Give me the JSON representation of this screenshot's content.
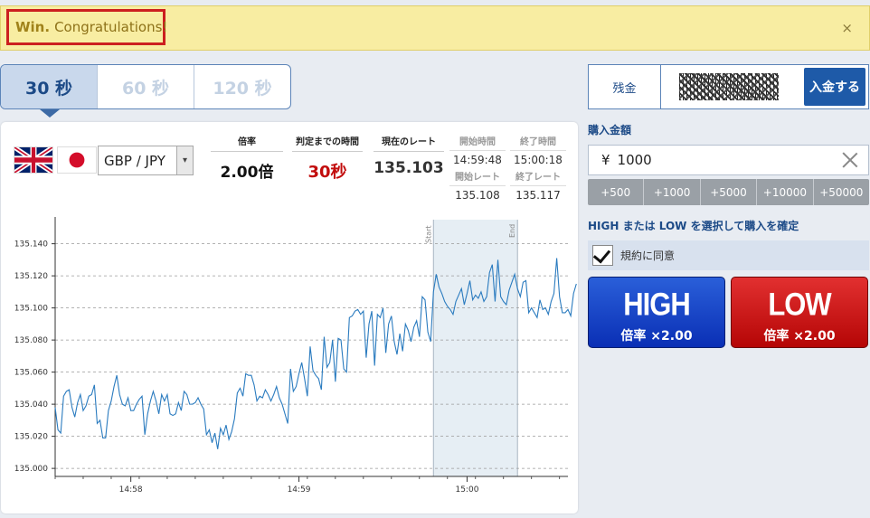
{
  "banner": {
    "strong": "Win.",
    "message": "Congratulations!",
    "close": "×"
  },
  "tabs": [
    {
      "label": "30 秒",
      "active": true
    },
    {
      "label": "60 秒",
      "active": false
    },
    {
      "label": "120 秒",
      "active": false
    }
  ],
  "pair": {
    "value": "GBP / JPY",
    "arrow": "▾"
  },
  "stats": {
    "payout": {
      "label": "倍率",
      "value": "2.00倍"
    },
    "time_left": {
      "label": "判定までの時間",
      "value": "30秒"
    },
    "current_rate": {
      "label": "現在のレート",
      "value": "135.103"
    },
    "start_time": {
      "label": "開始時間",
      "value": "14:59:48"
    },
    "end_time": {
      "label": "終了時間",
      "value": "15:00:18"
    },
    "start_rate": {
      "label": "開始レート",
      "value": "135.108"
    },
    "end_rate": {
      "label": "終了レート",
      "value": "135.117"
    }
  },
  "balance": {
    "label": "残金",
    "deposit_label": "入金する"
  },
  "purchase": {
    "title": "購入金額",
    "currency": "¥",
    "amount": "1000",
    "quick_amounts": [
      "+500",
      "+1000",
      "+5000",
      "+10000",
      "+50000"
    ],
    "confirm_text": "HIGH または LOW を選択して購入を確定",
    "agree_label": "規約に同意",
    "agree_checked": true
  },
  "high_button": {
    "title": "HIGH",
    "rate": "倍率 ×2.00",
    "color": "#0a2fb5"
  },
  "low_button": {
    "title": "LOW",
    "rate": "倍率 ×2.00",
    "color": "#b50606"
  },
  "colors": {
    "accent": "#1c4a87",
    "line": "#2a7bbf",
    "win_border": "#cc1f1f"
  },
  "chart_data": {
    "type": "line",
    "ylim": [
      134.995,
      135.155
    ],
    "yticks": [
      135.0,
      135.02,
      135.04,
      135.06,
      135.08,
      135.1,
      135.12,
      135.14
    ],
    "ytick_labels": [
      "135.000",
      "135.020",
      "135.040",
      "135.060",
      "135.080",
      "135.100",
      "135.120",
      "135.140"
    ],
    "xticks": [
      {
        "t": 27,
        "label": "14:58"
      },
      {
        "t": 87,
        "label": "14:59"
      },
      {
        "t": 147,
        "label": "15:00"
      }
    ],
    "xlim": [
      0,
      183
    ],
    "window": {
      "start": 135,
      "end": 165,
      "start_label": "Start",
      "end_label": "End"
    },
    "grid": true,
    "series": [
      {
        "values": [
          135.038,
          135.024,
          135.022,
          135.045,
          135.048,
          135.049,
          135.038,
          135.032,
          135.041,
          135.046,
          135.036,
          135.039,
          135.045,
          135.046,
          135.052,
          135.028,
          135.03,
          135.019,
          135.019,
          135.036,
          135.042,
          135.051,
          135.058,
          135.046,
          135.04,
          135.039,
          135.044,
          135.036,
          135.036,
          135.04,
          135.043,
          135.045,
          135.021,
          135.034,
          135.042,
          135.048,
          135.042,
          135.034,
          135.046,
          135.042,
          135.046,
          135.034,
          135.033,
          135.034,
          135.041,
          135.036,
          135.048,
          135.046,
          135.04,
          135.04,
          135.041,
          135.044,
          135.04,
          135.037,
          135.021,
          135.024,
          135.016,
          135.022,
          135.012,
          135.025,
          135.021,
          135.027,
          135.018,
          135.023,
          135.031,
          135.047,
          135.05,
          135.045,
          135.059,
          135.058,
          135.058,
          135.052,
          135.042,
          135.045,
          135.044,
          135.049,
          135.046,
          135.042,
          135.046,
          135.051,
          135.044,
          135.04,
          135.034,
          135.028,
          135.062,
          135.048,
          135.051,
          135.059,
          135.066,
          135.056,
          135.045,
          135.076,
          135.061,
          135.058,
          135.056,
          135.049,
          135.082,
          135.063,
          135.066,
          135.08,
          135.054,
          135.081,
          135.08,
          135.062,
          135.06,
          135.094,
          135.095,
          135.098,
          135.099,
          135.096,
          135.098,
          135.069,
          135.09,
          135.098,
          135.064,
          135.096,
          135.094,
          135.1,
          135.072,
          135.09,
          135.095,
          135.079,
          135.071,
          135.084,
          135.073,
          135.09,
          135.086,
          135.079,
          135.088,
          135.092,
          135.082,
          135.107,
          135.105,
          135.085,
          135.079,
          135.11,
          135.121,
          135.113,
          135.109,
          135.104,
          135.101,
          135.099,
          135.096,
          135.104,
          135.108,
          135.112,
          135.102,
          135.109,
          135.117,
          135.105,
          135.108,
          135.106,
          135.11,
          135.104,
          135.107,
          135.122,
          135.127,
          135.104,
          135.13,
          135.107,
          135.104,
          135.102,
          135.111,
          135.116,
          135.121,
          135.112,
          135.107,
          135.116,
          135.117,
          135.097,
          135.1,
          135.097,
          135.094,
          135.105,
          135.099,
          135.1,
          135.096,
          135.104,
          135.109,
          135.131,
          135.107,
          135.097,
          135.097,
          135.099,
          135.095,
          135.109,
          135.115
        ]
      }
    ]
  }
}
